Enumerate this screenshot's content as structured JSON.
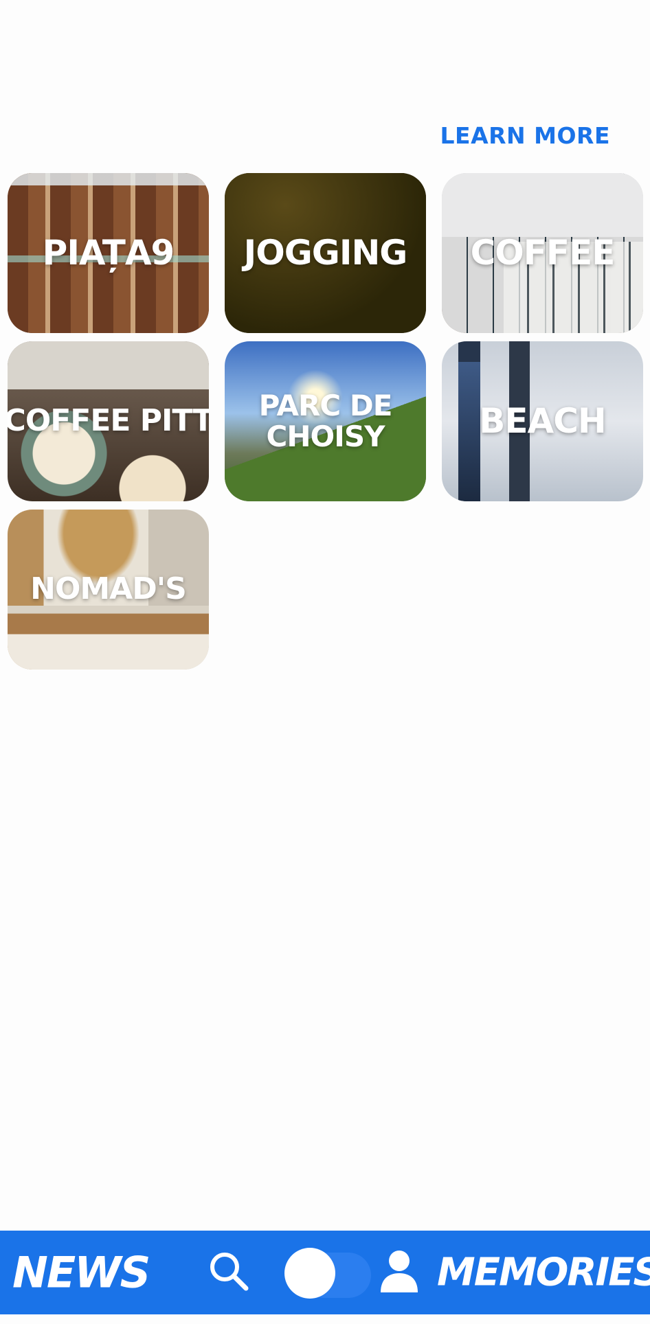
{
  "header": {
    "learn_more_label": "LEARN MORE"
  },
  "tiles": [
    {
      "label": "PIAȚA9"
    },
    {
      "label": "JOGGING"
    },
    {
      "label": "COFFEE"
    },
    {
      "label": "COFFEE PITT"
    },
    {
      "label": "PARC DE CHOISY"
    },
    {
      "label": "BEACH"
    },
    {
      "label": "NOMAD'S"
    }
  ],
  "navbar": {
    "news_label": "NEWS",
    "memories_label": "MEMORIES",
    "icons": [
      "search-icon",
      "toggle-switch",
      "person-icon"
    ],
    "color": "#1a73e8"
  },
  "colors": {
    "accent": "#1a73e8",
    "background": "#fdfdfd"
  }
}
